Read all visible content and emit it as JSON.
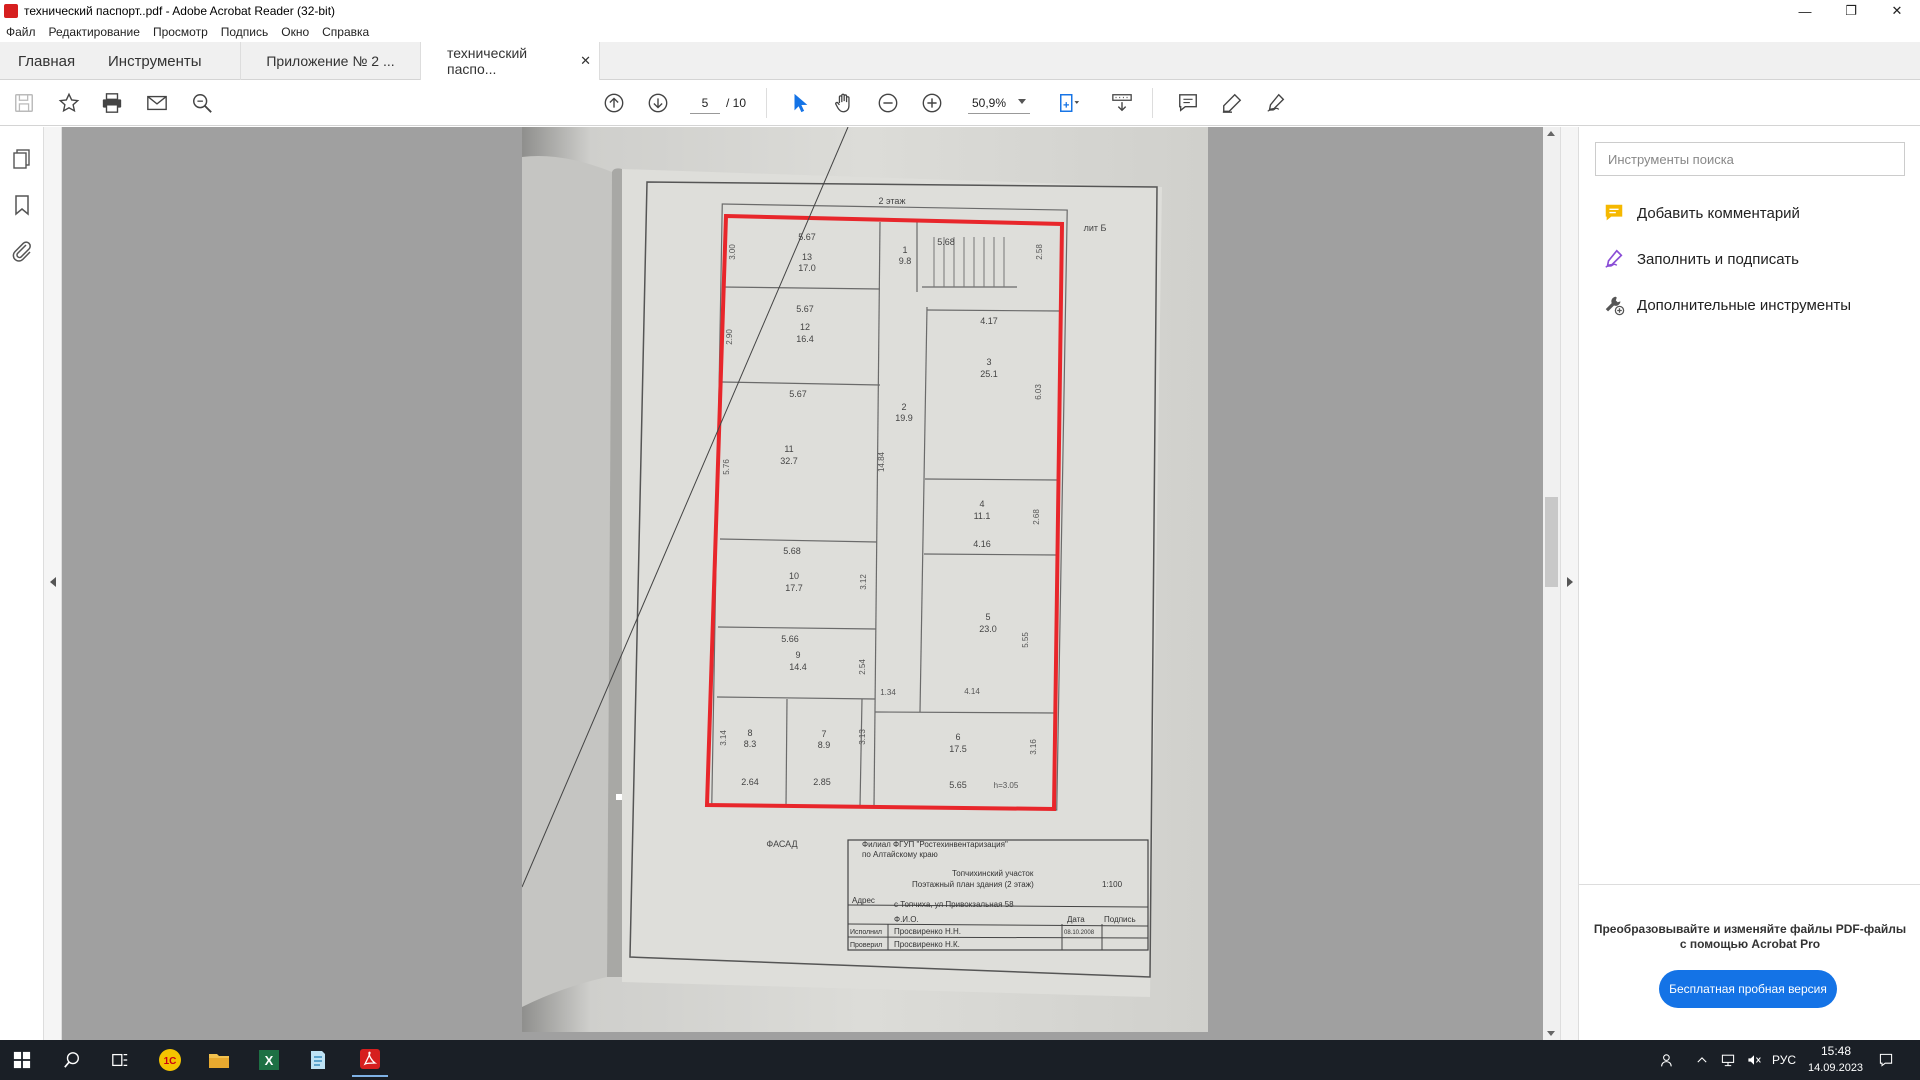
{
  "window": {
    "title": "технический паспорт..pdf - Adobe Acrobat Reader (32-bit)",
    "minimize": "—",
    "restore": "❐",
    "close": "✕"
  },
  "menu": [
    "Файл",
    "Редактирование",
    "Просмотр",
    "Подпись",
    "Окно",
    "Справка"
  ],
  "tabs": {
    "home": "Главная",
    "tools": "Инструменты",
    "doc1": "Приложение № 2 ...",
    "doc2": "технический паспо...",
    "close": "✕"
  },
  "toolbar": {
    "page_current": "5",
    "page_total": "/ 10",
    "zoom": "50,9%"
  },
  "rightpane": {
    "search_placeholder": "Инструменты поиска",
    "tools": [
      "Добавить комментарий",
      "Заполнить и подписать",
      "Дополнительные инструменты"
    ],
    "promo_text": "Преобразовывайте и изменяйте файлы PDF-файлы с помощью Acrobat Pro",
    "promo_button": "Бесплатная пробная версия"
  },
  "plan": {
    "floor_label": "2 этаж",
    "lit_label": "лит Б",
    "facade": "ФАСАД",
    "stamp": {
      "org1": "Филиал ФГУП \"Ростехинвентаризация\"",
      "org2": "по Алтайскому краю",
      "dept": "Топчихинский участок",
      "plan_title": "Поэтажный план здания (2 этаж)",
      "scale": "1:100",
      "address_label": "Адрес",
      "address": "с Топчиха, ул Привокзальная 58",
      "fio": "Ф.И.О.",
      "date_label": "Дата",
      "sign_label": "Подпись",
      "executor_label": "Исполнил",
      "executor": "Просвиренко Н.Н.",
      "checker_label": "Проверил",
      "checker": "Просвиренко Н.К.",
      "date": "08.10.2008"
    },
    "rooms": [
      {
        "num": "13",
        "area": "17.0",
        "dim": "5.67"
      },
      {
        "num": "1",
        "area": "9.8",
        "dim": "5.68"
      },
      {
        "num": "12",
        "area": "16.4",
        "dim": "5.67"
      },
      {
        "num": "3",
        "area": "25.1",
        "dim": "4.17"
      },
      {
        "num": "11",
        "area": "32.7",
        "dim": "5.67"
      },
      {
        "num": "2",
        "area": "19.9",
        "dim": "14.84"
      },
      {
        "num": "4",
        "area": "11.1",
        "dim": "4.16"
      },
      {
        "num": "10",
        "area": "17.7",
        "dim": "5.68"
      },
      {
        "num": "5",
        "area": "23.0",
        "dim": "5.55"
      },
      {
        "num": "9",
        "area": "14.4",
        "dim": "5.66"
      },
      {
        "num": "8",
        "area": "8.3",
        "dim": "2.64"
      },
      {
        "num": "7",
        "area": "8.9",
        "dim": "2.85"
      },
      {
        "num": "6",
        "area": "17.5",
        "dim": "5.65"
      }
    ],
    "dims": [
      "3.00",
      "2.90",
      "5.76",
      "3.12",
      "2.54",
      "3.14",
      "3.13",
      "2.58",
      "6.03",
      "2.68",
      "1.34",
      "4.14",
      "3.16",
      "h=3.05"
    ]
  },
  "taskbar": {
    "lang": "РУС",
    "time": "15:48",
    "date": "14.09.2023"
  }
}
